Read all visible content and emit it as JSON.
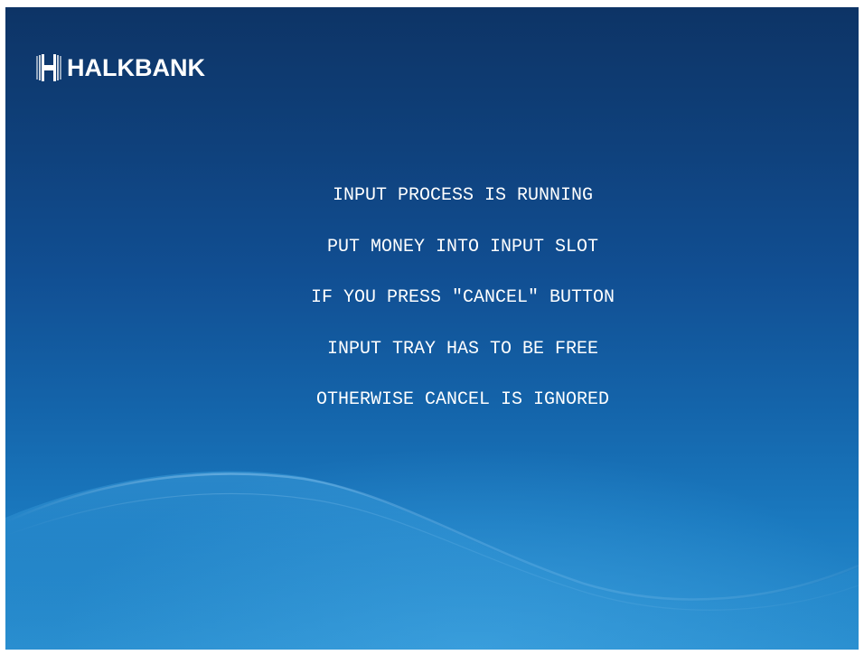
{
  "brand": {
    "name": "HALKBANK",
    "logo_icon": "halkbank-logo-mark"
  },
  "messages": [
    "INPUT PROCESS IS RUNNING",
    "PUT MONEY INTO INPUT SLOT",
    "IF YOU PRESS \"CANCEL\" BUTTON",
    "INPUT TRAY HAS TO BE FREE",
    "OTHERWISE CANCEL IS IGNORED"
  ],
  "colors": {
    "background_top": "#0d3466",
    "background_bottom": "#2a8fd0",
    "text": "#ffffff"
  }
}
